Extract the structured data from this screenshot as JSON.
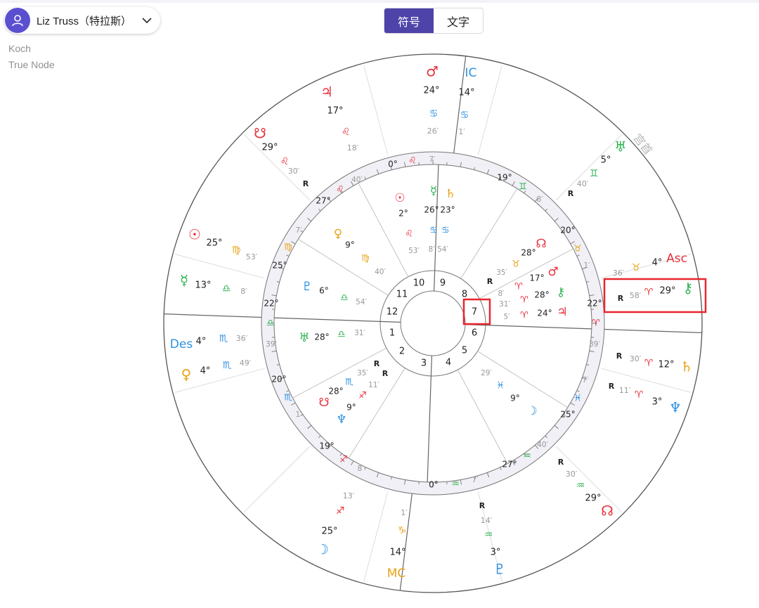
{
  "user": {
    "name": "Liz Truss（特拉斯）"
  },
  "meta": {
    "house_system": "Koch",
    "node_type": "True Node"
  },
  "view_toggle": {
    "options": [
      "符号",
      "文字"
    ],
    "active": "符号"
  },
  "colors": {
    "accent": "#4e43a8",
    "fire": "#e8303a",
    "earth": "#e8a317",
    "air": "#2fb352",
    "water": "#2b8fe0",
    "highlight": "#e8262d"
  },
  "outer_labels": {
    "ic": "IC",
    "mc": "MC",
    "asc": "Asc",
    "des": "Des",
    "house_cusp_word": "宫首"
  },
  "houses": [
    "1",
    "2",
    "3",
    "4",
    "5",
    "6",
    "7",
    "8",
    "9",
    "10",
    "11",
    "12"
  ],
  "cusps": [
    {
      "house": "1",
      "deg": "22°",
      "sign": "Libra",
      "min": "39′"
    },
    {
      "house": "2",
      "deg": "20°",
      "sign": "Scorpio",
      "min": "1′"
    },
    {
      "house": "3",
      "deg": "19°",
      "sign": "Sagittarius",
      "min": "8′"
    },
    {
      "house": "4",
      "deg": "0°",
      "sign": "Aquarius",
      "min": "7′"
    },
    {
      "house": "5",
      "deg": "27°",
      "sign": "Aquarius",
      "min": "40′"
    },
    {
      "house": "6",
      "deg": "25°",
      "sign": "Pisces",
      "min": "7′"
    },
    {
      "house": "7",
      "deg": "22°",
      "sign": "Aries",
      "min": "39′"
    },
    {
      "house": "8",
      "deg": "20°",
      "sign": "Taurus",
      "min": "1′"
    },
    {
      "house": "9",
      "deg": "19°",
      "sign": "Gemini",
      "min": "8′"
    },
    {
      "house": "10",
      "deg": "0°",
      "sign": "Leo",
      "min": "7′"
    },
    {
      "house": "11",
      "deg": "27°",
      "sign": "Leo",
      "min": "40′"
    },
    {
      "house": "12",
      "deg": "25°",
      "sign": "Virgo",
      "min": "7′"
    }
  ],
  "inner_planets": [
    {
      "planet": "Sun",
      "deg": "2°",
      "sign": "Leo",
      "min": "53′",
      "r": ""
    },
    {
      "planet": "Mercury",
      "deg": "26°",
      "sign": "Cancer",
      "min": "8′",
      "r": ""
    },
    {
      "planet": "Saturn",
      "deg": "23°",
      "sign": "Cancer",
      "min": "54′",
      "r": ""
    },
    {
      "planet": "Venus",
      "deg": "9°",
      "sign": "Virgo",
      "min": "40′",
      "r": ""
    },
    {
      "planet": "Pluto",
      "deg": "6°",
      "sign": "Libra",
      "min": "54′",
      "r": ""
    },
    {
      "planet": "Uranus",
      "deg": "28°",
      "sign": "Libra",
      "min": "31′",
      "r": ""
    },
    {
      "planet": "South Node",
      "deg": "28°",
      "sign": "Scorpio",
      "min": "35′",
      "r": "R"
    },
    {
      "planet": "Neptune",
      "deg": "9°",
      "sign": "Sagittarius",
      "min": "11′",
      "r": "R"
    },
    {
      "planet": "Moon",
      "deg": "9°",
      "sign": "Pisces",
      "min": "29′",
      "r": ""
    },
    {
      "planet": "Mars",
      "deg": "17°",
      "sign": "Aries",
      "min": "8′",
      "r": ""
    },
    {
      "planet": "North Node",
      "deg": "28°",
      "sign": "Taurus",
      "min": "35′",
      "r": "R"
    },
    {
      "planet": "Chiron",
      "deg": "28°",
      "sign": "Aries",
      "min": "31′",
      "r": ""
    },
    {
      "planet": "Jupiter",
      "deg": "24°",
      "sign": "Aries",
      "min": "5′",
      "r": ""
    }
  ],
  "outer_planets": [
    {
      "planet": "Mars",
      "deg": "24°",
      "sign": "Cancer",
      "min": "26′",
      "r": ""
    },
    {
      "planet": "IC",
      "deg": "14°",
      "sign": "Cancer",
      "min": "1′",
      "r": ""
    },
    {
      "planet": "Jupiter",
      "deg": "17°",
      "sign": "Leo",
      "min": "18′",
      "r": ""
    },
    {
      "planet": "South Node",
      "deg": "29°",
      "sign": "Leo",
      "min": "30′",
      "r": "R"
    },
    {
      "planet": "Uranus",
      "deg": "5°",
      "sign": "Gemini",
      "min": "40′",
      "r": "R"
    },
    {
      "planet": "Asc",
      "deg": "4°",
      "sign": "Taurus",
      "min": "36′",
      "r": ""
    },
    {
      "planet": "Chiron",
      "deg": "29°",
      "sign": "Aries",
      "min": "58′",
      "r": "R"
    },
    {
      "planet": "Saturn",
      "deg": "12°",
      "sign": "Aries",
      "min": "30′",
      "r": "R"
    },
    {
      "planet": "Neptune",
      "deg": "3°",
      "sign": "Aries",
      "min": "11′",
      "r": "R"
    },
    {
      "planet": "Sun",
      "deg": "25°",
      "sign": "Virgo",
      "min": "53′",
      "r": ""
    },
    {
      "planet": "Mercury",
      "deg": "13°",
      "sign": "Libra",
      "min": "8′",
      "r": ""
    },
    {
      "planet": "Des",
      "deg": "4°",
      "sign": "Scorpio",
      "min": "36′",
      "r": ""
    },
    {
      "planet": "Venus",
      "deg": "4°",
      "sign": "Scorpio",
      "min": "49′",
      "r": ""
    },
    {
      "planet": "Moon",
      "deg": "25°",
      "sign": "Sagittarius",
      "min": "13′",
      "r": ""
    },
    {
      "planet": "MC",
      "deg": "14°",
      "sign": "Capricorn",
      "min": "1′",
      "r": ""
    },
    {
      "planet": "Pluto",
      "deg": "3°",
      "sign": "Aquarius",
      "min": "14′",
      "r": "R"
    },
    {
      "planet": "North Node",
      "deg": "29°",
      "sign": "Aquarius",
      "min": "30′",
      "r": "R"
    }
  ]
}
